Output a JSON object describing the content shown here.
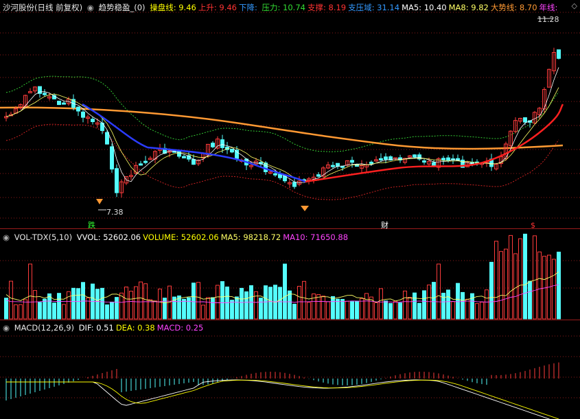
{
  "main_header": {
    "title": "沙河股份(日线 前复权)",
    "indicator": "趋势稳盈_(0)",
    "items": [
      {
        "label": "操盘线:",
        "value": "9.46",
        "color": "#ffff00"
      },
      {
        "label": "上升:",
        "value": "9.46",
        "color": "#ff3333"
      },
      {
        "label": "下降:",
        "value": "",
        "color": "#3399ff"
      },
      {
        "label": "压力:",
        "value": "10.74",
        "color": "#33dd33"
      },
      {
        "label": "支撑:",
        "value": "8.19",
        "color": "#ff3333"
      },
      {
        "label": "支压域:",
        "value": "31.14",
        "color": "#3399ff"
      },
      {
        "label": "MA5:",
        "value": "10.40",
        "color": "#ffffff"
      },
      {
        "label": "MA8:",
        "value": "9.82",
        "color": "#ffff66"
      },
      {
        "label": "大势线:",
        "value": "8.70",
        "color": "#ff9933"
      },
      {
        "label": "年线:",
        "value": "",
        "color": "#ff44ff"
      }
    ]
  },
  "price_labels": {
    "high": "11.28",
    "low": "7.38"
  },
  "markers": {
    "fall": "跌",
    "finance": "财",
    "special": "$"
  },
  "vol_header": {
    "name": "VOL-TDX(5,10)",
    "items": [
      {
        "label": "VVOL:",
        "value": "52602.06",
        "color": "#ffffff"
      },
      {
        "label": "VOLUME:",
        "value": "52602.06",
        "color": "#ffff00"
      },
      {
        "label": "MA5:",
        "value": "98218.72",
        "color": "#ffff66"
      },
      {
        "label": "MA10:",
        "value": "71650.88",
        "color": "#ff44ff"
      }
    ]
  },
  "macd_header": {
    "name": "MACD(12,26,9)",
    "items": [
      {
        "label": "DIF:",
        "value": "0.51",
        "color": "#ffffff"
      },
      {
        "label": "DEA:",
        "value": "0.38",
        "color": "#ffff00"
      },
      {
        "label": "MACD:",
        "value": "0.25",
        "color": "#ff44ff"
      }
    ]
  },
  "colors": {
    "up": "#ff3c3c",
    "down": "#54fcfc",
    "grid": "#8b1a1a",
    "ma_short": "#ffffff",
    "ma_long": "#ffff66",
    "trend": "#ff9933",
    "down_line": "#2b3cff",
    "up_line": "#ff2020"
  }
}
